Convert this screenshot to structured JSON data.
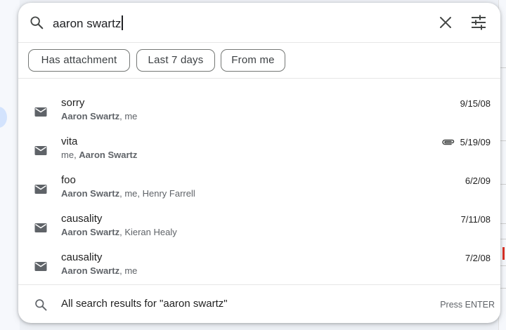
{
  "search": {
    "query": "aaron swartz",
    "clear_icon": "close-icon",
    "options_icon": "tune-icon"
  },
  "chips": [
    {
      "label": "Has attachment"
    },
    {
      "label": "Last 7 days"
    },
    {
      "label": "From me"
    }
  ],
  "results": [
    {
      "subject": "sorry",
      "people": [
        {
          "name": "Aaron Swartz",
          "bold": true
        },
        {
          "name": "me",
          "bold": false
        }
      ],
      "date": "9/15/08",
      "attachment": false
    },
    {
      "subject": "vita",
      "people": [
        {
          "name": "me",
          "bold": false
        },
        {
          "name": "Aaron Swartz",
          "bold": true
        }
      ],
      "date": "5/19/09",
      "attachment": true
    },
    {
      "subject": "foo",
      "people": [
        {
          "name": "Aaron Swartz",
          "bold": true
        },
        {
          "name": "me",
          "bold": false
        },
        {
          "name": "Henry Farrell",
          "bold": false
        }
      ],
      "date": "6/2/09",
      "attachment": false
    },
    {
      "subject": "causality",
      "people": [
        {
          "name": "Aaron Swartz",
          "bold": true
        },
        {
          "name": "Kieran Healy",
          "bold": false
        }
      ],
      "date": "7/11/08",
      "attachment": false
    },
    {
      "subject": "causality",
      "people": [
        {
          "name": "Aaron Swartz",
          "bold": true
        },
        {
          "name": "me",
          "bold": false
        }
      ],
      "date": "7/2/08",
      "attachment": false
    }
  ],
  "footer": {
    "all_results": "All search results for \"aaron swartz\"",
    "press": "Press ENTER"
  },
  "colors": {
    "panel_bg": "#ffffff",
    "text": "#1f1f1f",
    "secondary_text": "#5f6368",
    "chip_border": "#747775"
  }
}
